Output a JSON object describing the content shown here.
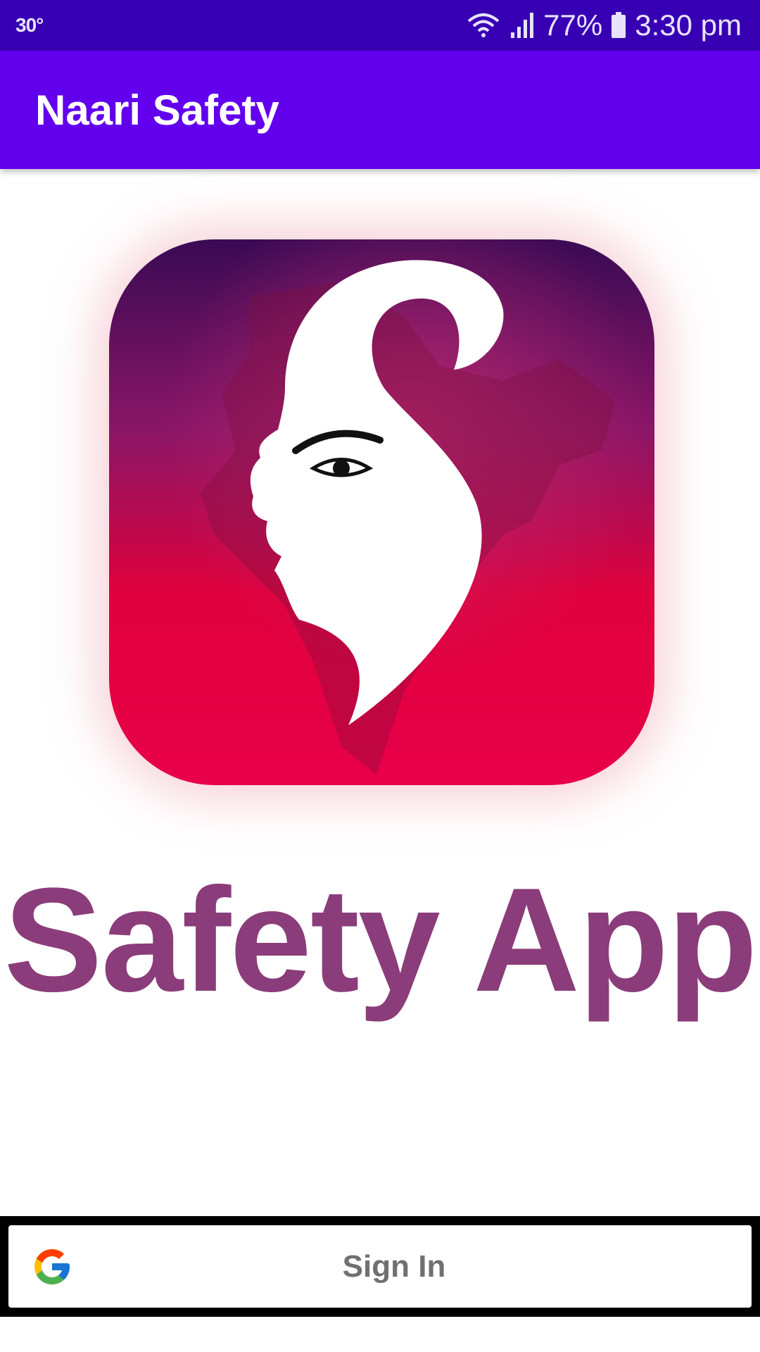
{
  "status_bar": {
    "temperature": "30°",
    "battery": "77%",
    "time": "3:30 pm",
    "icons": [
      "wifi-icon",
      "signal-icon",
      "battery-icon"
    ]
  },
  "app_bar": {
    "title": "Naari Safety"
  },
  "logo": {
    "icon": "safety-logo-icon",
    "colors": {
      "top": "#3a0a55",
      "middle": "#a8125a",
      "bottom": "#e8003a"
    }
  },
  "headline": "Safety App",
  "signin": {
    "label": "Sign In",
    "icon": "google-icon"
  },
  "colors": {
    "status_bar": "#3700b3",
    "app_bar": "#6200ee",
    "headline": "#8a3d7a",
    "signin_text": "#707070"
  }
}
